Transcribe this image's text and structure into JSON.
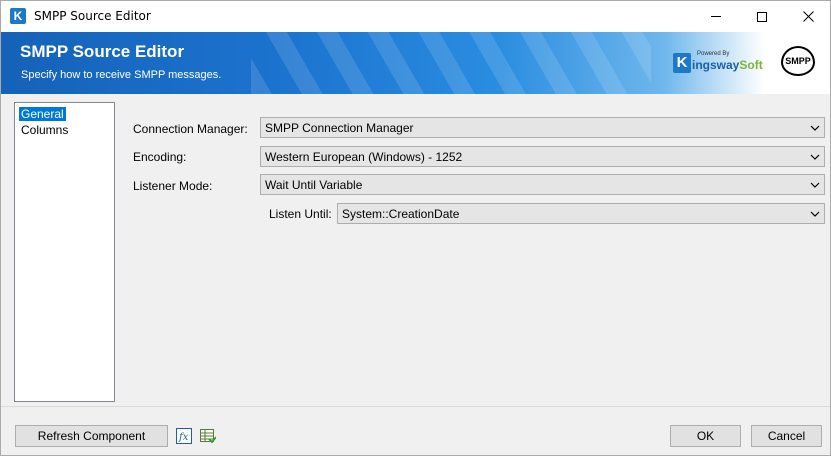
{
  "window": {
    "title": "SMPP Source Editor",
    "app_icon_letter": "K"
  },
  "banner": {
    "title": "SMPP Source Editor",
    "subtitle": "Specify how to receive SMPP messages.",
    "brand_powered": "Powered By",
    "brand_letter": "K",
    "brand_name_main": "ingsway",
    "brand_name_accent": "Soft",
    "smpp_logo_text": "SMPP"
  },
  "sidebar": {
    "items": [
      {
        "label": "General",
        "selected": true
      },
      {
        "label": "Columns",
        "selected": false
      }
    ]
  },
  "form": {
    "connection_manager": {
      "label": "Connection Manager:",
      "value": "SMPP Connection Manager"
    },
    "encoding": {
      "label": "Encoding:",
      "value": "Western European (Windows) - 1252"
    },
    "listener_mode": {
      "label": "Listener Mode:",
      "value": "Wait Until Variable"
    },
    "listen_until": {
      "label": "Listen Until:",
      "value": "System::CreationDate"
    }
  },
  "footer": {
    "refresh_label": "Refresh Component",
    "ok_label": "OK",
    "cancel_label": "Cancel",
    "expression_icon_text": "fx"
  },
  "colors": {
    "banner_blue": "#1c74cf",
    "selection_blue": "#0078d7",
    "brand_green": "#7fb33a"
  }
}
